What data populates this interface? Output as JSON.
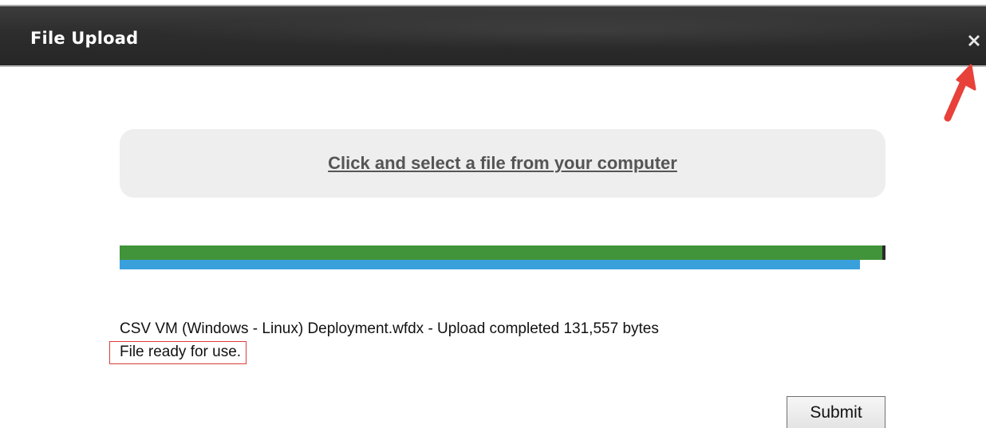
{
  "dialog": {
    "title": "File Upload",
    "close_icon": "close-x-icon"
  },
  "upload": {
    "select_link_text": "Click and select a file from your computer",
    "progress_green_percent": 100,
    "progress_blue_percent": 96.7,
    "status_text": "CSV VM (Windows - Linux) Deployment.wfdx - Upload completed 131,557 bytes",
    "ready_text": "File ready for use.",
    "submit_label": "Submit"
  },
  "annotations": {
    "arrow_color": "#e8413a",
    "highlight_color": "#e03a3a"
  },
  "colors": {
    "titlebar": "#2d2d2d",
    "progress_green": "#41943a",
    "progress_blue": "#3aa0dc",
    "select_area_bg": "#eeeeee"
  }
}
